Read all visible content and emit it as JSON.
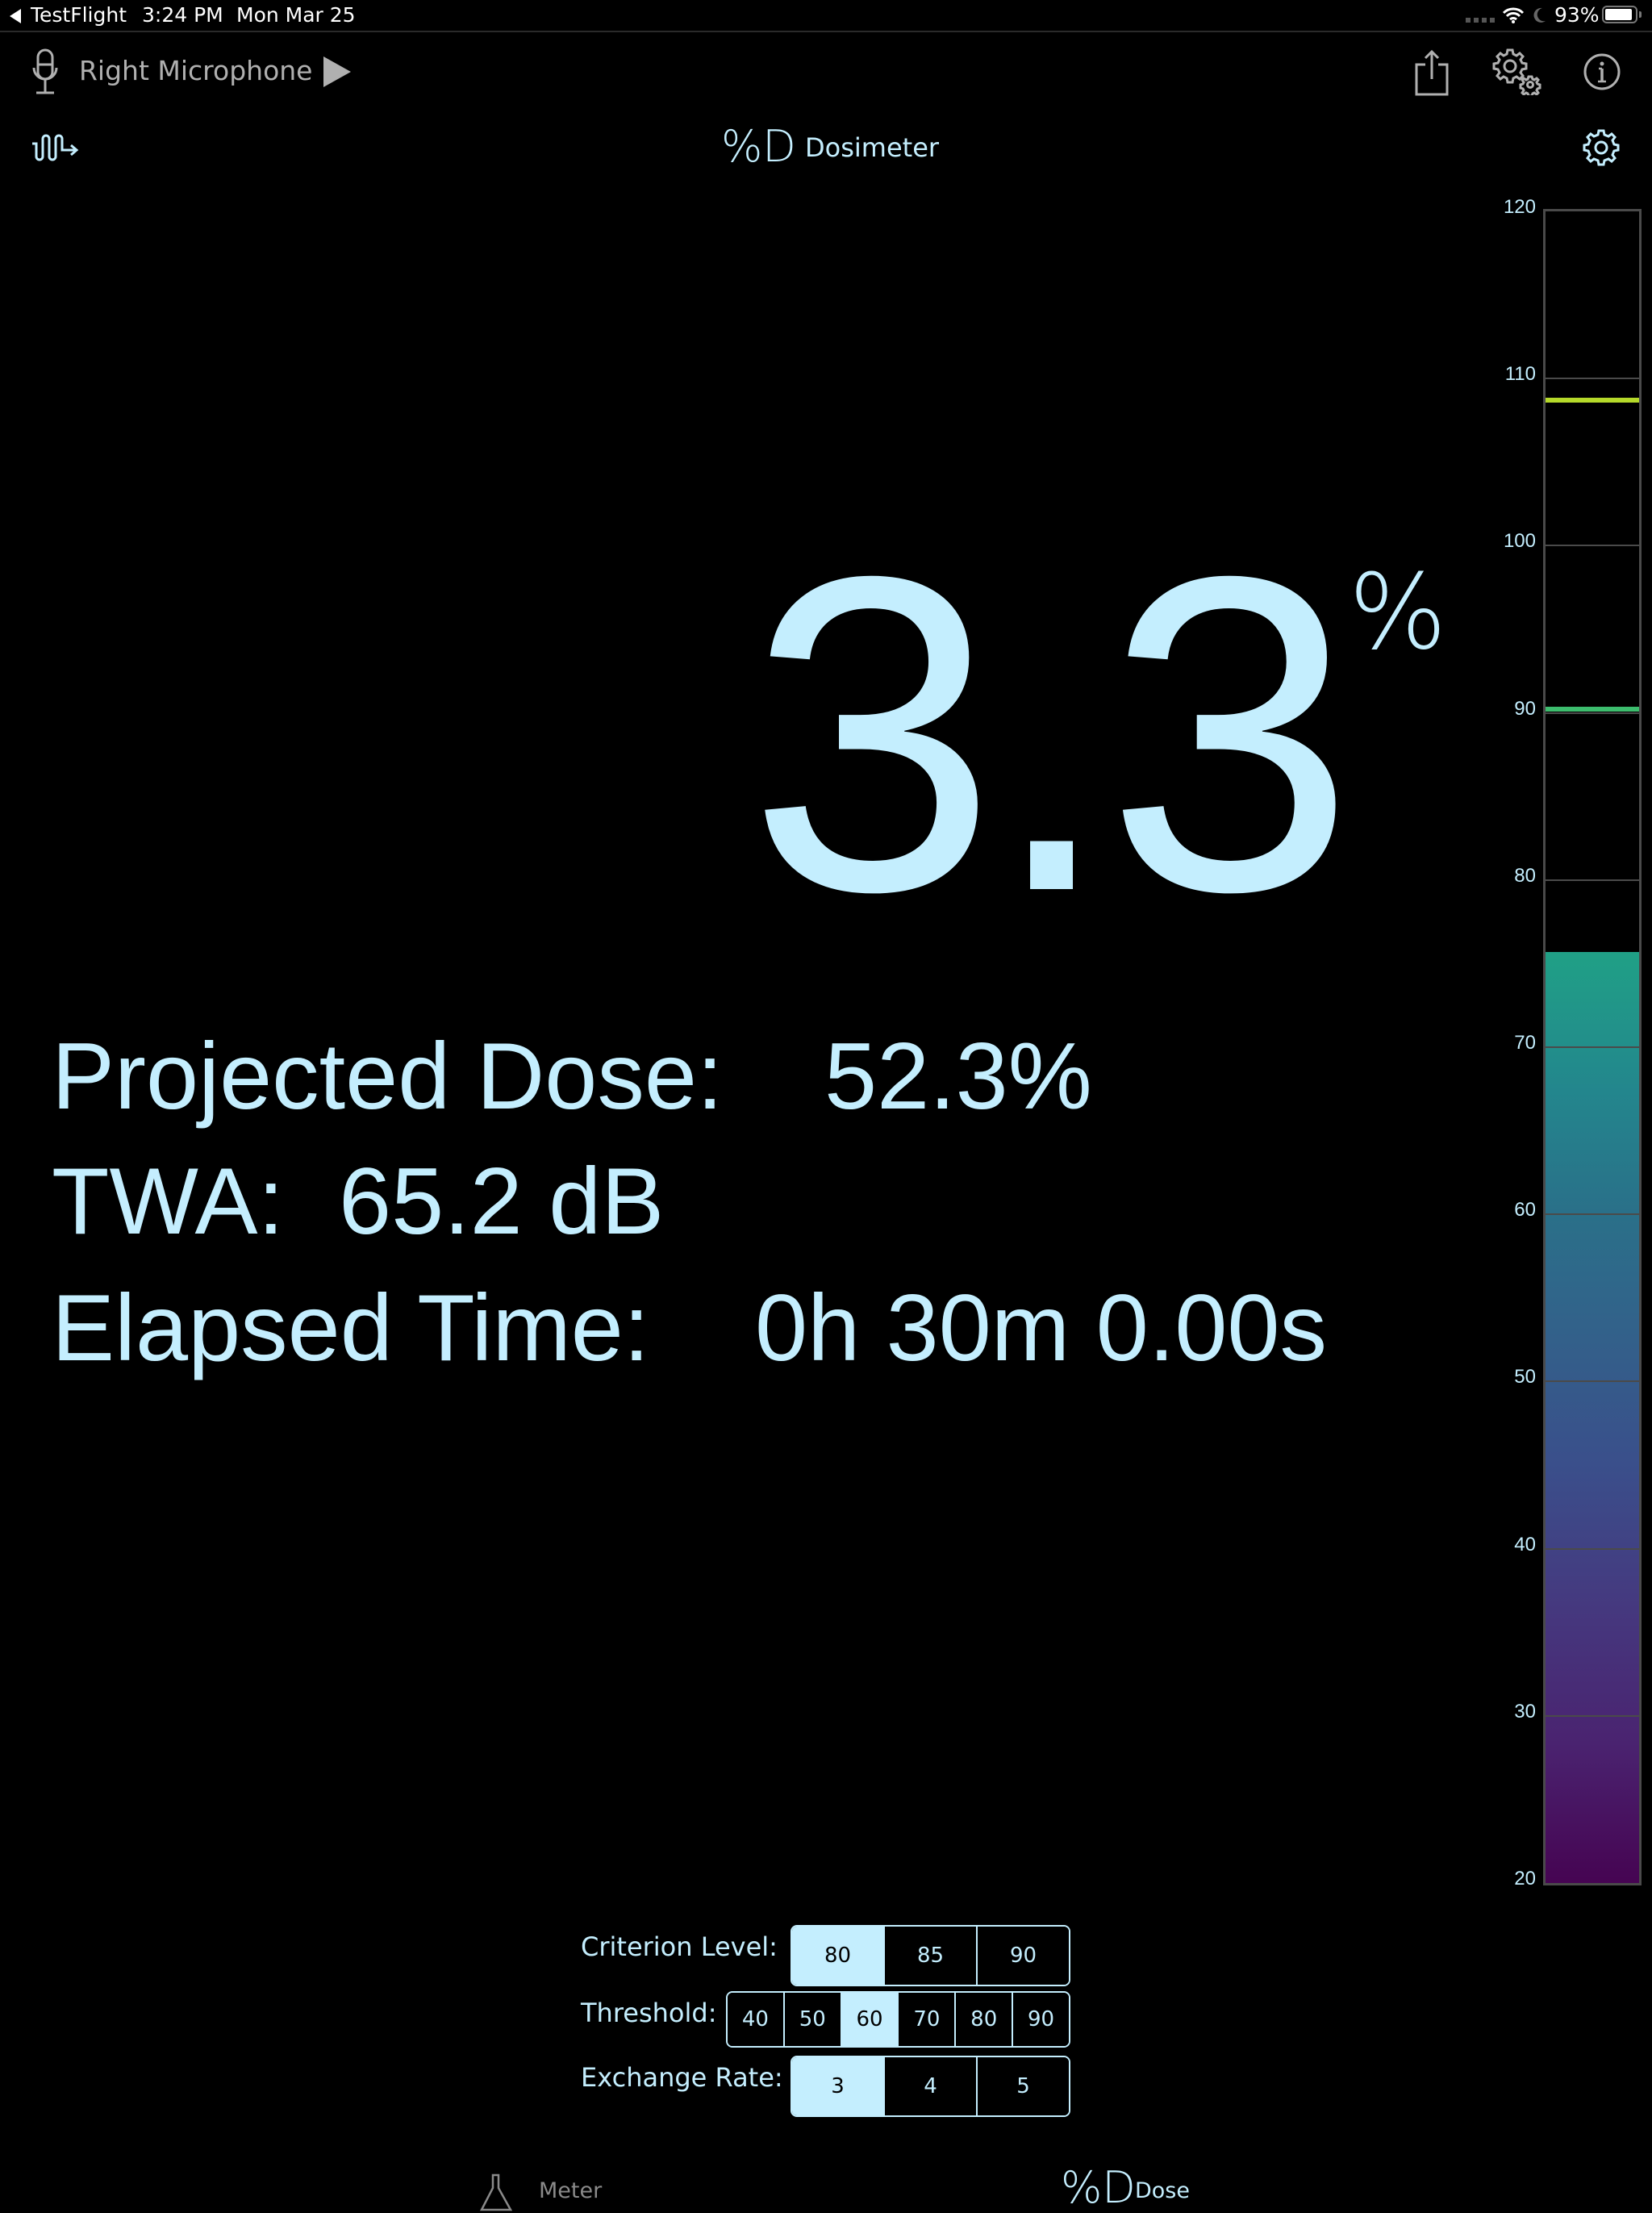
{
  "status_bar": {
    "back_app": "TestFlight",
    "time": "3:24 PM",
    "date": "Mon Mar 25",
    "battery": "93%",
    "back_icon": "back-triangle-icon",
    "wifi_icon": "wifi-icon",
    "moon_icon": "do-not-disturb-moon-icon",
    "battery_icon": "battery-icon"
  },
  "toolbar": {
    "input_device": "Right Microphone",
    "mic_icon": "microphone-icon",
    "play_icon": "play-icon",
    "share_icon": "share-icon",
    "settings_icon": "gears-icon",
    "info_icon": "info-icon"
  },
  "header": {
    "left_icon": "waveform-arrow-icon",
    "mode_symbol": "%D",
    "title": "Dosimeter",
    "right_icon": "gear-icon"
  },
  "dose": {
    "value": "3.3",
    "unit": "%",
    "projected_label": "Projected Dose:",
    "projected_value": "52.3%",
    "twa_label": "TWA:",
    "twa_value": "65.2 dB",
    "elapsed_label": "Elapsed Time:",
    "elapsed_value": "0h 30m 0.00s"
  },
  "level_meter": {
    "unit": "dB",
    "range": [
      20,
      120
    ],
    "tick_labels": [
      "120",
      "110",
      "100",
      "90",
      "80",
      "70",
      "60",
      "50",
      "40",
      "30",
      "20"
    ],
    "current_level_db": 75.7,
    "peak_marker_db": 108.7,
    "peak_marker_color": "#b5d92a",
    "secondary_marker_db": 90.2,
    "secondary_marker_color": "#3dbd6e"
  },
  "controls": {
    "criterion": {
      "label": "Criterion Level:",
      "options": [
        "80",
        "85",
        "90"
      ],
      "selected": "80"
    },
    "threshold": {
      "label": "Threshold:",
      "options": [
        "40",
        "50",
        "60",
        "70",
        "80",
        "90"
      ],
      "selected": "60"
    },
    "exchange_rate": {
      "label": "Exchange Rate:",
      "options": [
        "3",
        "4",
        "5"
      ],
      "selected": "3"
    }
  },
  "tabs": [
    {
      "label": "Meter",
      "icon": "flask-icon",
      "active": false
    },
    {
      "label": "Dose",
      "symbol": "%D",
      "icon": "percent-d-icon",
      "active": true
    }
  ],
  "colors": {
    "accent": "#c4eefe",
    "inactive": "#8a8a8a",
    "background": "#000000"
  }
}
